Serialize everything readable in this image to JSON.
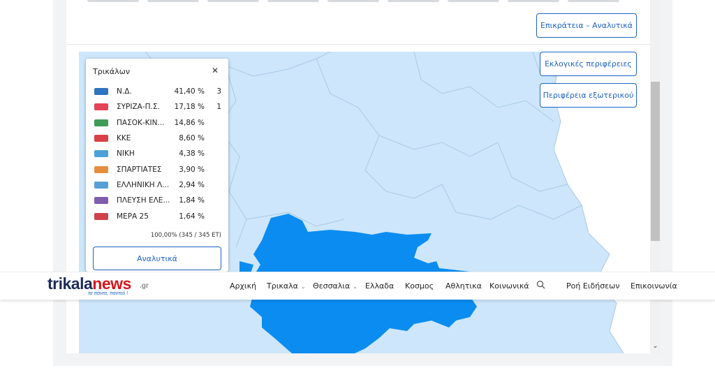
{
  "controls": {
    "territory_button": "Επικράτεια – Αναλυτικά",
    "regions_button": "Εκλογικές περιφέρειες",
    "abroad_button": "Περιφέρεια εξωτερικού"
  },
  "popup": {
    "title": "Τρικάλων",
    "close_glyph": "✕",
    "parties": [
      {
        "logo": "nd-logo",
        "name": "Ν.Δ.",
        "percent": "41,40 %",
        "seats": "3",
        "color": "#0c5bb5"
      },
      {
        "logo": "syriza-logo",
        "name": "ΣΥΡΙΖΑ-Π.Σ.",
        "percent": "17,18 %",
        "seats": "1",
        "color": "#e0223a"
      },
      {
        "logo": "pasok-logo",
        "name": "ΠΑΣΟΚ-ΚΙΝ...",
        "percent": "14,86 %",
        "seats": "",
        "color": "#1d8a3a"
      },
      {
        "logo": "kke-logo",
        "name": "ΚΚΕ",
        "percent": "8,60 %",
        "seats": "",
        "color": "#d21f24"
      },
      {
        "logo": "niki-logo",
        "name": "ΝΙΚΗ",
        "percent": "4,38 %",
        "seats": "",
        "color": "#2e8fd4"
      },
      {
        "logo": "spartiates-logo",
        "name": "ΣΠΑΡΤΙΑΤΕΣ",
        "percent": "3,90 %",
        "seats": "",
        "color": "#e07a1c"
      },
      {
        "logo": "elliniki-lysi-logo",
        "name": "ΕΛΛΗΝΙΚΗ Λ...",
        "percent": "2,94 %",
        "seats": "",
        "color": "#3a8fd0"
      },
      {
        "logo": "plefsi-logo",
        "name": "ΠΛΕΥΣΗ ΕΛΕ...",
        "percent": "1,84 %",
        "seats": "",
        "color": "#6a3fa0"
      },
      {
        "logo": "mera25-logo",
        "name": "ΜΕΡΑ 25",
        "percent": "1,64 %",
        "seats": "",
        "color": "#c8202b"
      }
    ],
    "total": "100,00% (345 / 345 ΕΤ)",
    "details_button": "Αναλυτικά"
  },
  "navbar": {
    "logo_trikala": "trikala",
    "logo_news": "news",
    "logo_gr": ".gr",
    "logo_slogan": "τα πάντα, παντού !",
    "items": [
      {
        "label": "Αρχική",
        "dropdown": false
      },
      {
        "label": "Τρικαλα",
        "dropdown": true
      },
      {
        "label": "Θεσσαλια",
        "dropdown": true
      },
      {
        "label": "Ελλαδα",
        "dropdown": false
      },
      {
        "label": "Κοσμος",
        "dropdown": false
      },
      {
        "label": "Αθλητικα",
        "dropdown": false
      },
      {
        "label": "Κοινωνικά",
        "dropdown": false
      },
      {
        "label": "Ροή Ειδήσεων",
        "dropdown": false
      },
      {
        "label": "Επικοινωνία",
        "dropdown": false
      }
    ],
    "chevron_glyph": "⌄",
    "search_icon": "search-icon"
  },
  "colors": {
    "accent": "#1c62c5",
    "map_region": "#cde6fb",
    "map_highlight": "#0b8cf0",
    "brand_dark": "#1c2c5b",
    "brand_red": "#d4161c"
  },
  "scroll_down_glyph": "⌄"
}
